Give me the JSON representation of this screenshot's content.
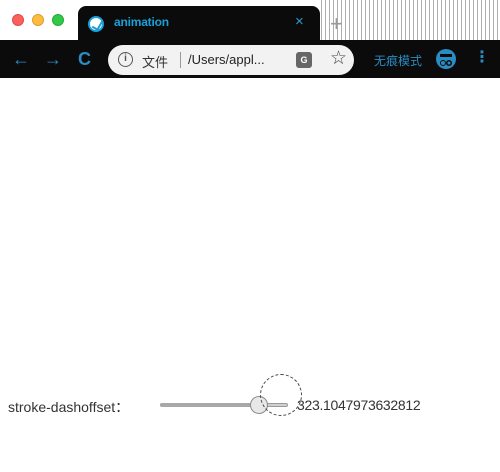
{
  "browser": {
    "tab": {
      "title": "animation",
      "close_glyph": "×",
      "favicon": "site-favicon-icon"
    },
    "new_tab_glyph": "+",
    "nav": {
      "back_glyph": "←",
      "forward_glyph": "→",
      "reload_glyph": "C"
    },
    "omnibox": {
      "info_glyph": "i",
      "site_label": "文件",
      "url": "/Users/appl...",
      "translate_glyph": "G",
      "star_glyph": "☆"
    },
    "incognito": {
      "label": "无痕模式",
      "icon": "incognito-icon"
    },
    "menu_glyph": "⋮"
  },
  "page": {
    "control": {
      "label": "stroke-dashoffset：",
      "value": "323.1047973632812",
      "slider_level": 0.82
    }
  },
  "colors": {
    "accent": "#2a8cc4",
    "chrome_background": "#0b0b0b",
    "page_background": "#ffffff"
  }
}
